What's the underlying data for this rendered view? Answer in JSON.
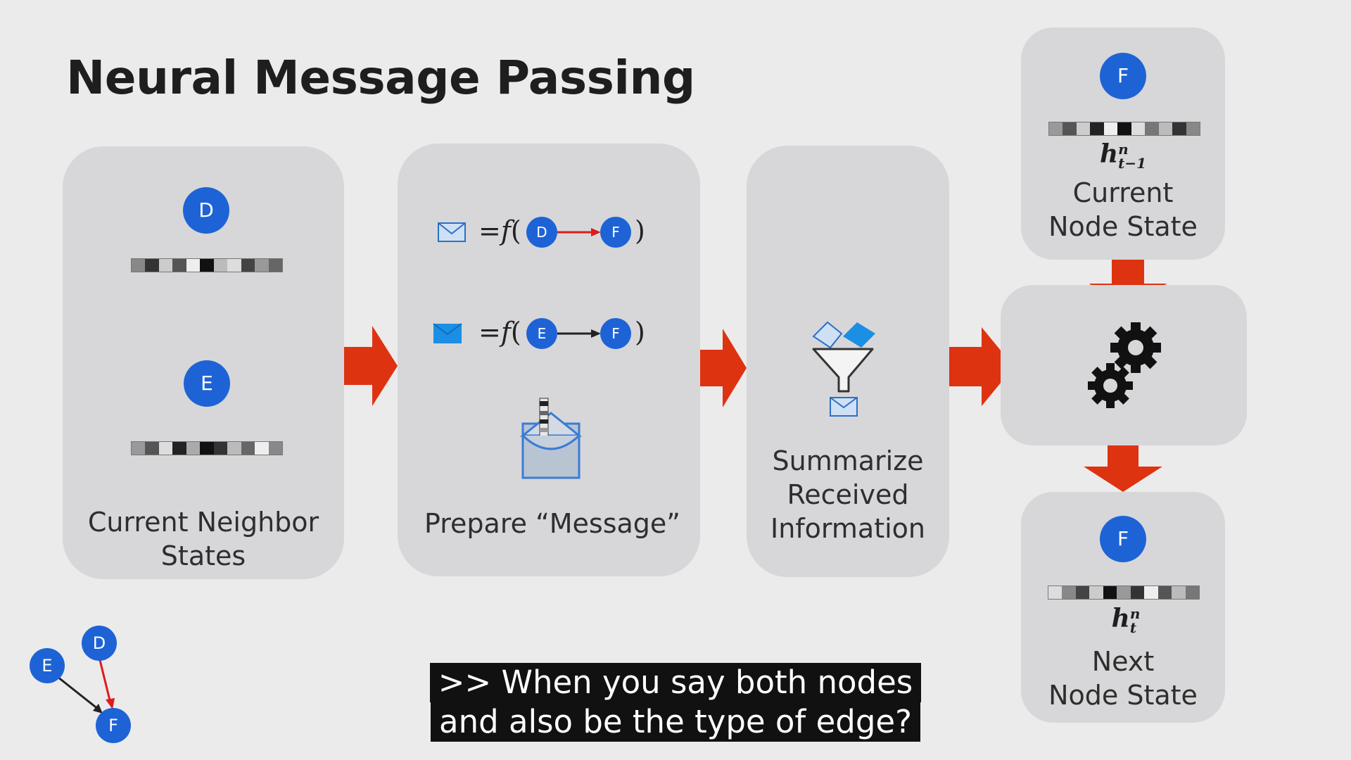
{
  "slide": {
    "title": "Neural Message Passing",
    "colors": {
      "node": "#1e63d6",
      "arrow": "#dd3311",
      "panel": "#d7d7d9",
      "background": "#ebebeb",
      "edge_red": "#e01b1b"
    }
  },
  "panels": {
    "neighbors": {
      "node_d": "D",
      "node_e": "E",
      "caption_line1": "Current Neighbor",
      "caption_line2": "States"
    },
    "message": {
      "eq1": "=𝑓(",
      "eq2": "=𝑓(",
      "close": ")",
      "node_d": "D",
      "node_e": "E",
      "node_f": "F",
      "caption": "Prepare “Message”"
    },
    "summarize": {
      "caption_line1": "Summarize",
      "caption_line2": "Received",
      "caption_line3": "Information"
    },
    "current_state": {
      "node": "F",
      "symbol": "𝒉",
      "sup": "n",
      "sub": "t−1",
      "caption_line1": "Current",
      "caption_line2": "Node State"
    },
    "update": {
      "icon": "gears-icon"
    },
    "next_state": {
      "node": "F",
      "symbol": "𝒉",
      "sup": "n",
      "sub": "t",
      "caption_line1": "Next",
      "caption_line2": "Node State"
    }
  },
  "graph": {
    "node_d": "D",
    "node_e": "E",
    "node_f": "F"
  },
  "subtitles": {
    "line1": ">> When you say both nodes",
    "line2": "and also be the type of edge?"
  }
}
